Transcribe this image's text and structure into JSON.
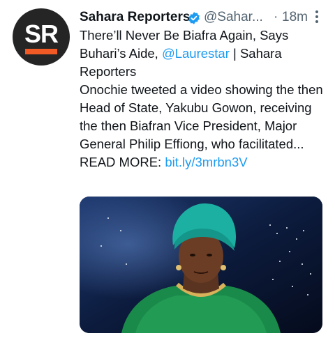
{
  "tweet": {
    "author_name": "Sahara Reporters",
    "handle": "@Sahar...",
    "separator": "·",
    "time": "18m",
    "avatar_text": "SR",
    "line1_title": "There’ll Never Be Biafra Again, Says Buhari’s Aide, ",
    "mention": "@Laurestar",
    "line1_suffix": " | Sahara Reporters",
    "summary": "Onochie tweeted a video showing the then Head of State, Yakubu Gowon, receiving the then Biafran Vice President, Major General Philip Effiong, who facilitated...",
    "read_more_label": "READ MORE: ",
    "read_more_link": "bit.ly/3mrbn3V"
  },
  "colors": {
    "link": "#1d9bf0",
    "verified": "#1d9bf0",
    "brand_orange": "#f15a24"
  },
  "icons": {
    "verified": "verified-badge-icon",
    "more": "more-vertical-icon"
  }
}
